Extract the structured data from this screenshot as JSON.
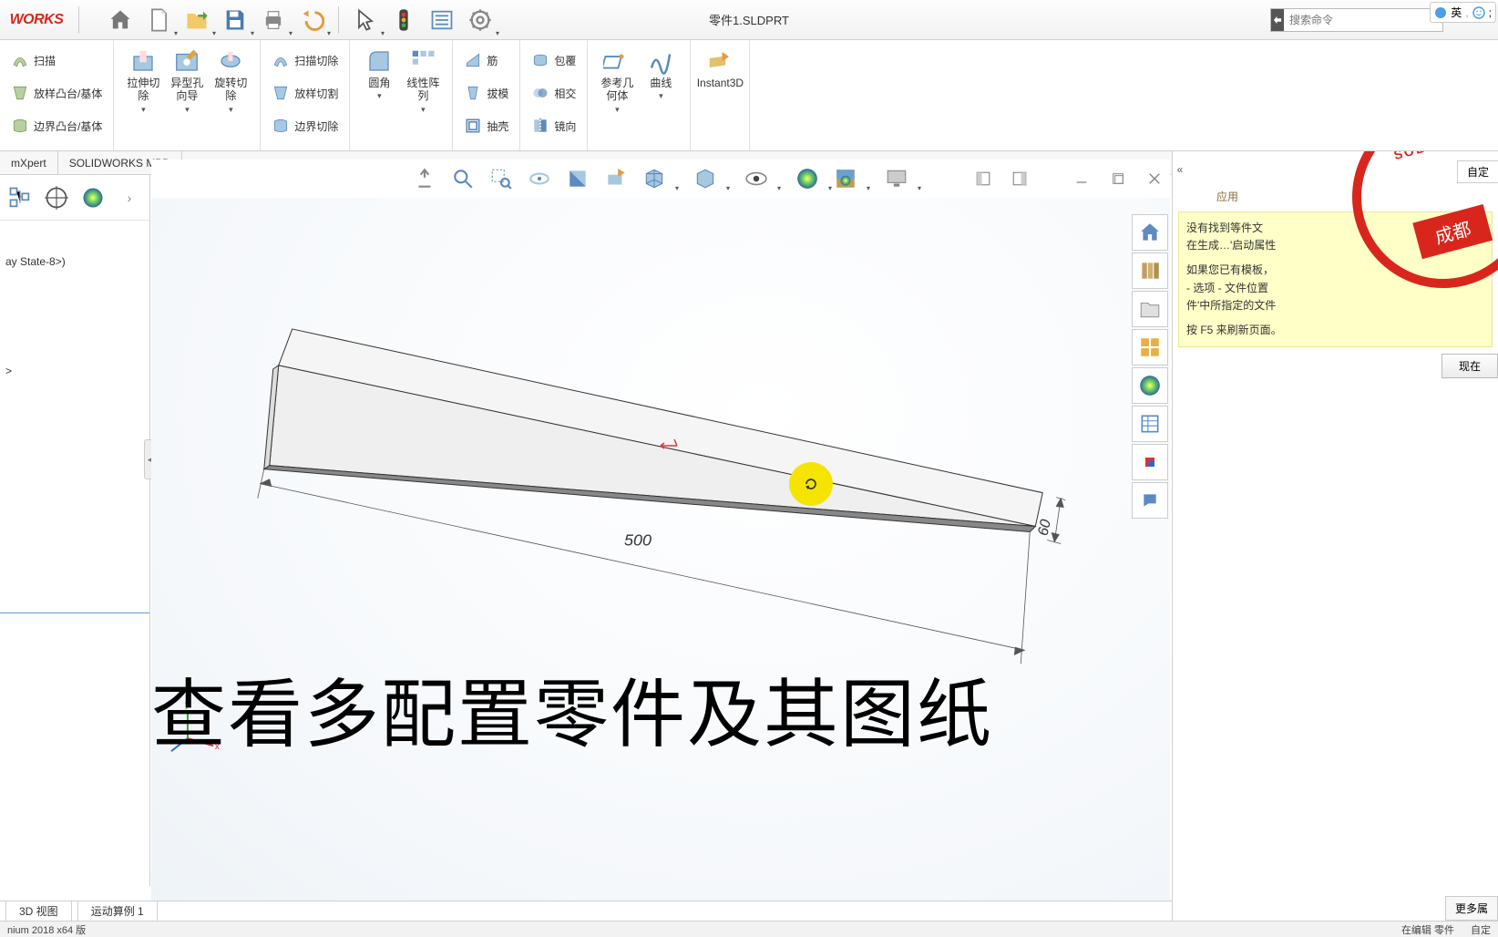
{
  "app": {
    "logo": "WORKS",
    "title": "零件1.SLDPRT",
    "search_placeholder": "搜索命令"
  },
  "ime": {
    "badge1": "英",
    "badge2": ";"
  },
  "qat": {
    "home": "home-icon",
    "new": "new-icon",
    "open": "open-icon",
    "save": "save-icon",
    "print": "print-icon",
    "undo": "undo-icon",
    "select": "select-icon",
    "rebuild": "rebuild-icon",
    "options": "options-icon",
    "settings": "settings-icon"
  },
  "ribbon": {
    "g1": {
      "sweep": "扫描",
      "loft": "放样凸台/基体",
      "boundary": "边界凸台/基体"
    },
    "g2": {
      "extrudecut": "拉伸切除",
      "holewizard": "异型孔向导",
      "revolvecut": "旋转切除"
    },
    "g3": {
      "sweepcut": "扫描切除",
      "loftcut": "放样切割",
      "boundarycut": "边界切除"
    },
    "g4": {
      "fillet": "圆角",
      "pattern": "线性阵列"
    },
    "g5": {
      "rib": "筋",
      "draft": "拔模",
      "shell": "抽壳"
    },
    "g6": {
      "wrap": "包覆",
      "intersect": "相交",
      "mirror": "镜向"
    },
    "g7": {
      "refgeom": "参考几何体",
      "curves": "曲线"
    },
    "g8": {
      "instant3d": "Instant3D"
    }
  },
  "sec_tabs": {
    "t1": "mXpert",
    "t2": "SOLIDWORKS MBD"
  },
  "left_panel": {
    "state": "ay State-8>)",
    "sel": ">"
  },
  "viewport": {
    "dim_length": "500",
    "dim_height": "60",
    "overlay": "查看多配置零件及其图纸"
  },
  "right_panel": {
    "tab_custom": "自定",
    "tab_apply": "应用",
    "stamp_arc": "SOLIDWO",
    "stamp_text": "成都",
    "note_l1": "没有找到等件文",
    "note_l2": "在生成…'启动属性",
    "note_l3": "如果您已有模板，",
    "note_l4": "- 选项 - 文件位置",
    "note_l5": "件'中所指定的文件",
    "note_l6": "按 F5 来刷新页面。",
    "btn_now": "现在",
    "bottom": "更多属"
  },
  "bottom_tabs": {
    "t1": "3D 视图",
    "t2": "运动算例 1"
  },
  "status": {
    "left": "nium 2018 x64 版",
    "right1": "在编辑 零件",
    "right2": "自定"
  },
  "colors": {
    "brand_red": "#d9261c",
    "highlight_yellow": "#f5e400",
    "note_bg": "#ffffc8"
  }
}
